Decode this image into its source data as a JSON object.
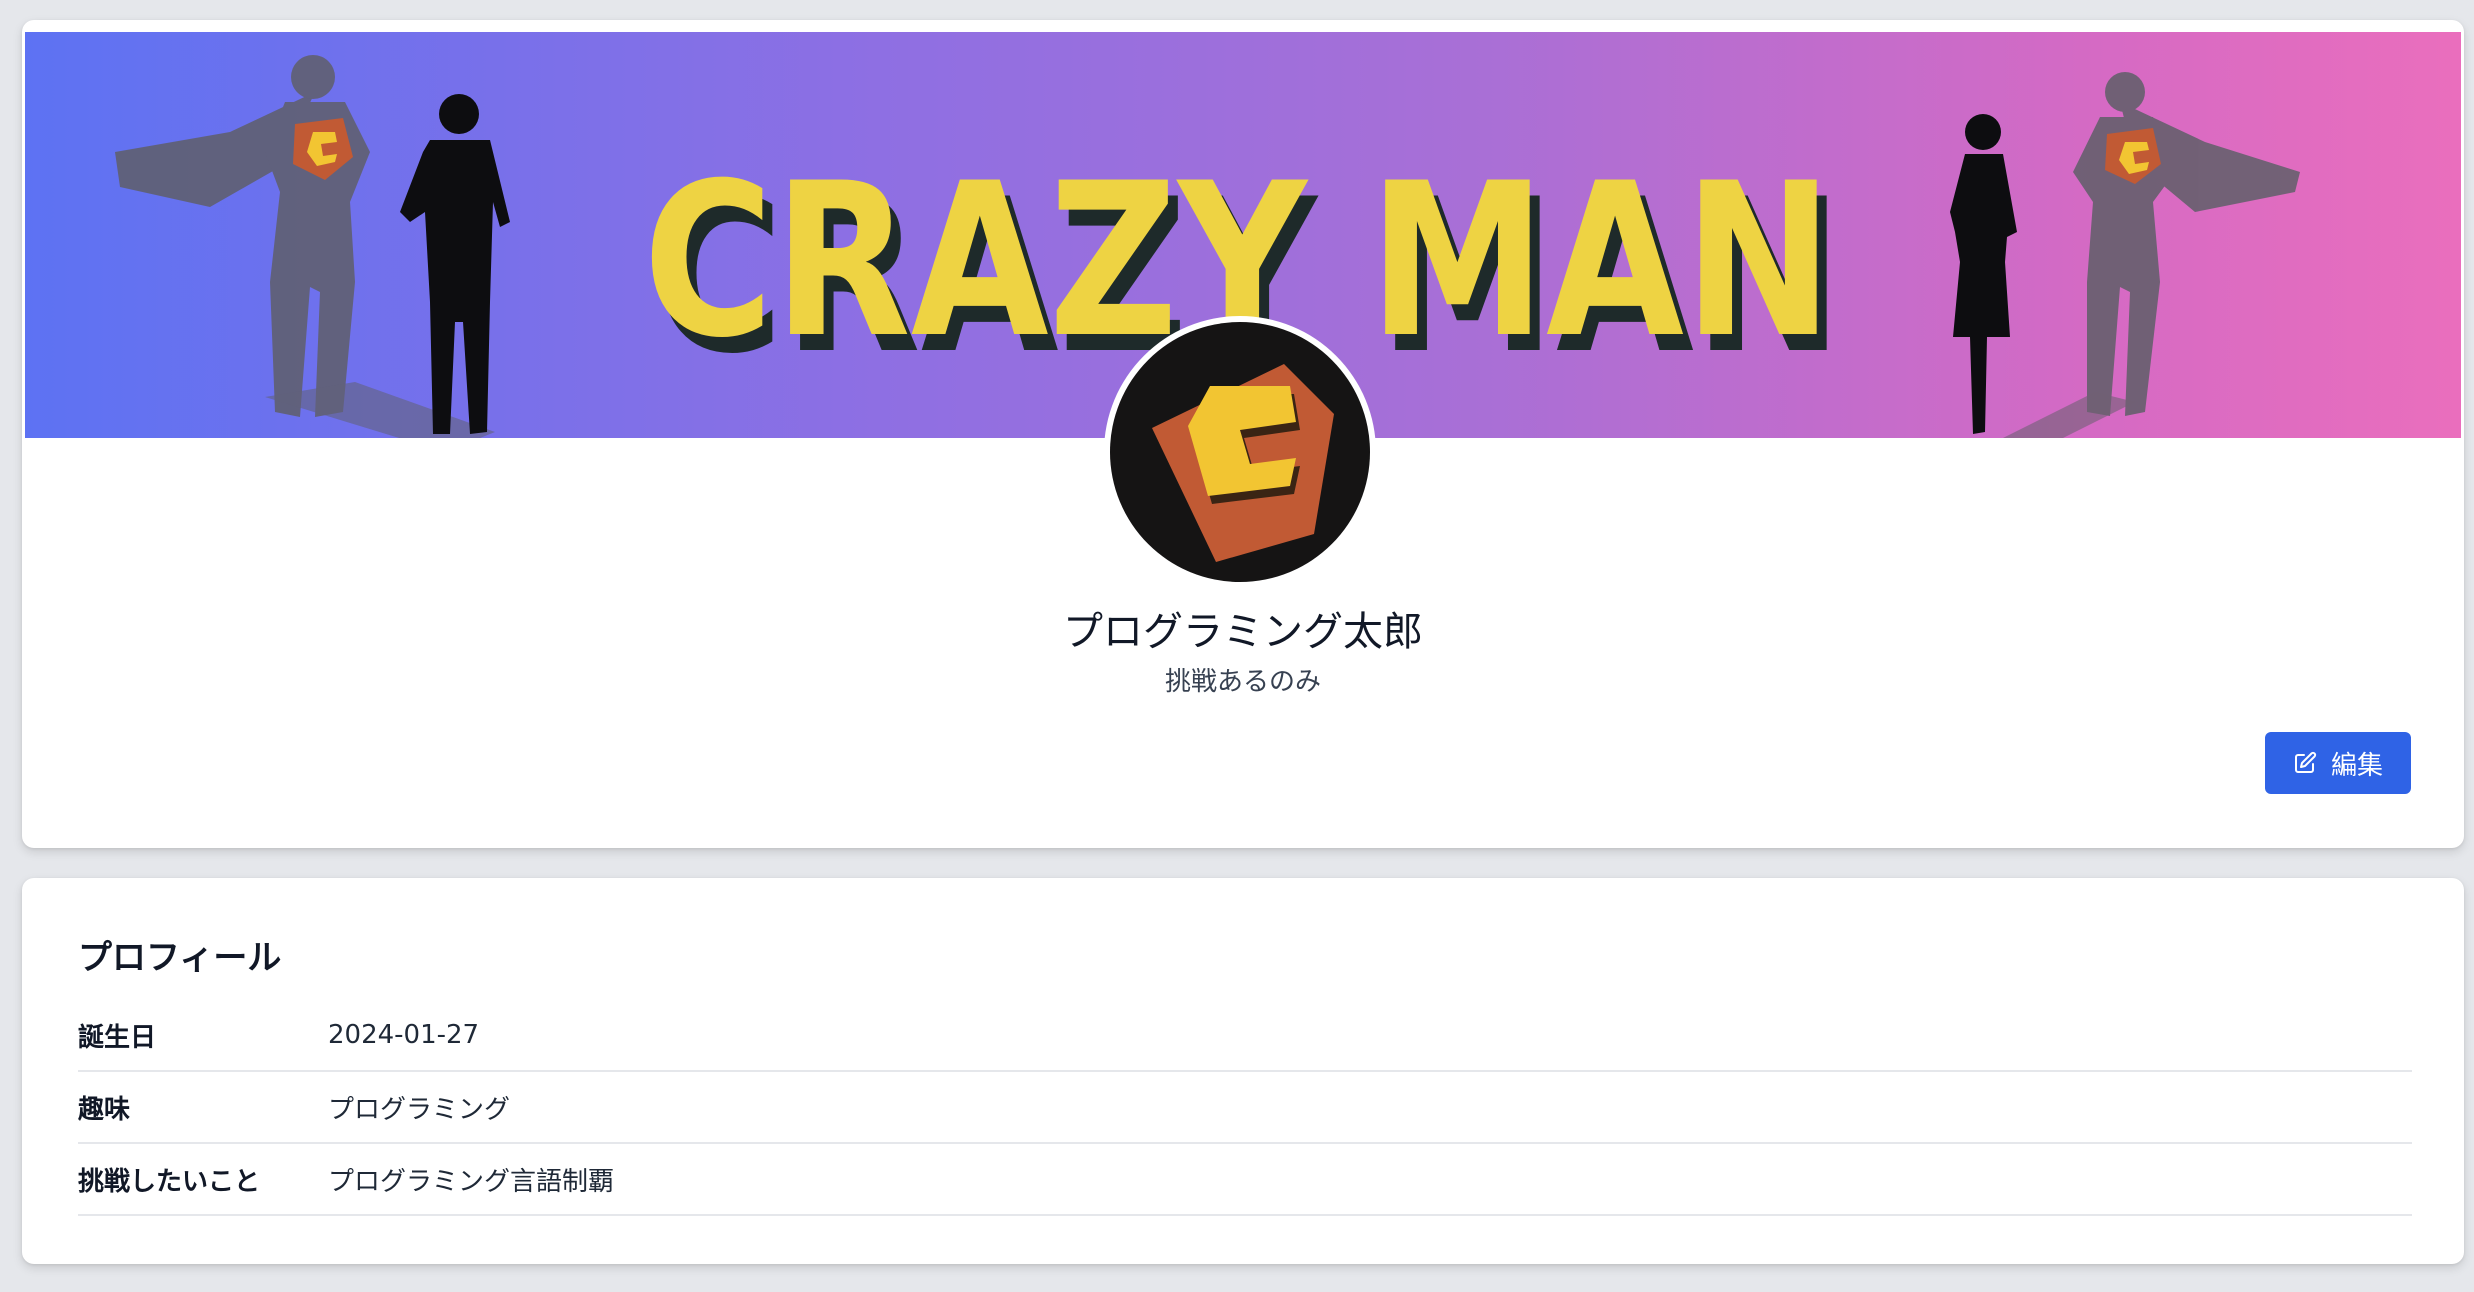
{
  "profile_card": {
    "banner": {
      "title": "CRAZY MAN",
      "colors": {
        "gradient_start": "#5d72f3",
        "gradient_end": "#ea6ebd",
        "title_fill": "#eed343",
        "title_shadow": "#1e2a2a"
      }
    },
    "avatar": {
      "icon": "c-emblem-icon",
      "colors": {
        "background": "#151414",
        "emblem": "#c15a34",
        "letter": "#f2c532"
      }
    },
    "name": "プログラミング太郎",
    "tagline": "挑戦あるのみ",
    "edit_button": {
      "label": "編集",
      "icon": "pencil-square-icon",
      "color": "#2f63e6"
    }
  },
  "details_card": {
    "title": "プロフィール",
    "rows": [
      {
        "label": "誕生日",
        "value": "2024-01-27"
      },
      {
        "label": "趣味",
        "value": "プログラミング"
      },
      {
        "label": "挑戦したいこと",
        "value": "プログラミング言語制覇"
      }
    ]
  }
}
